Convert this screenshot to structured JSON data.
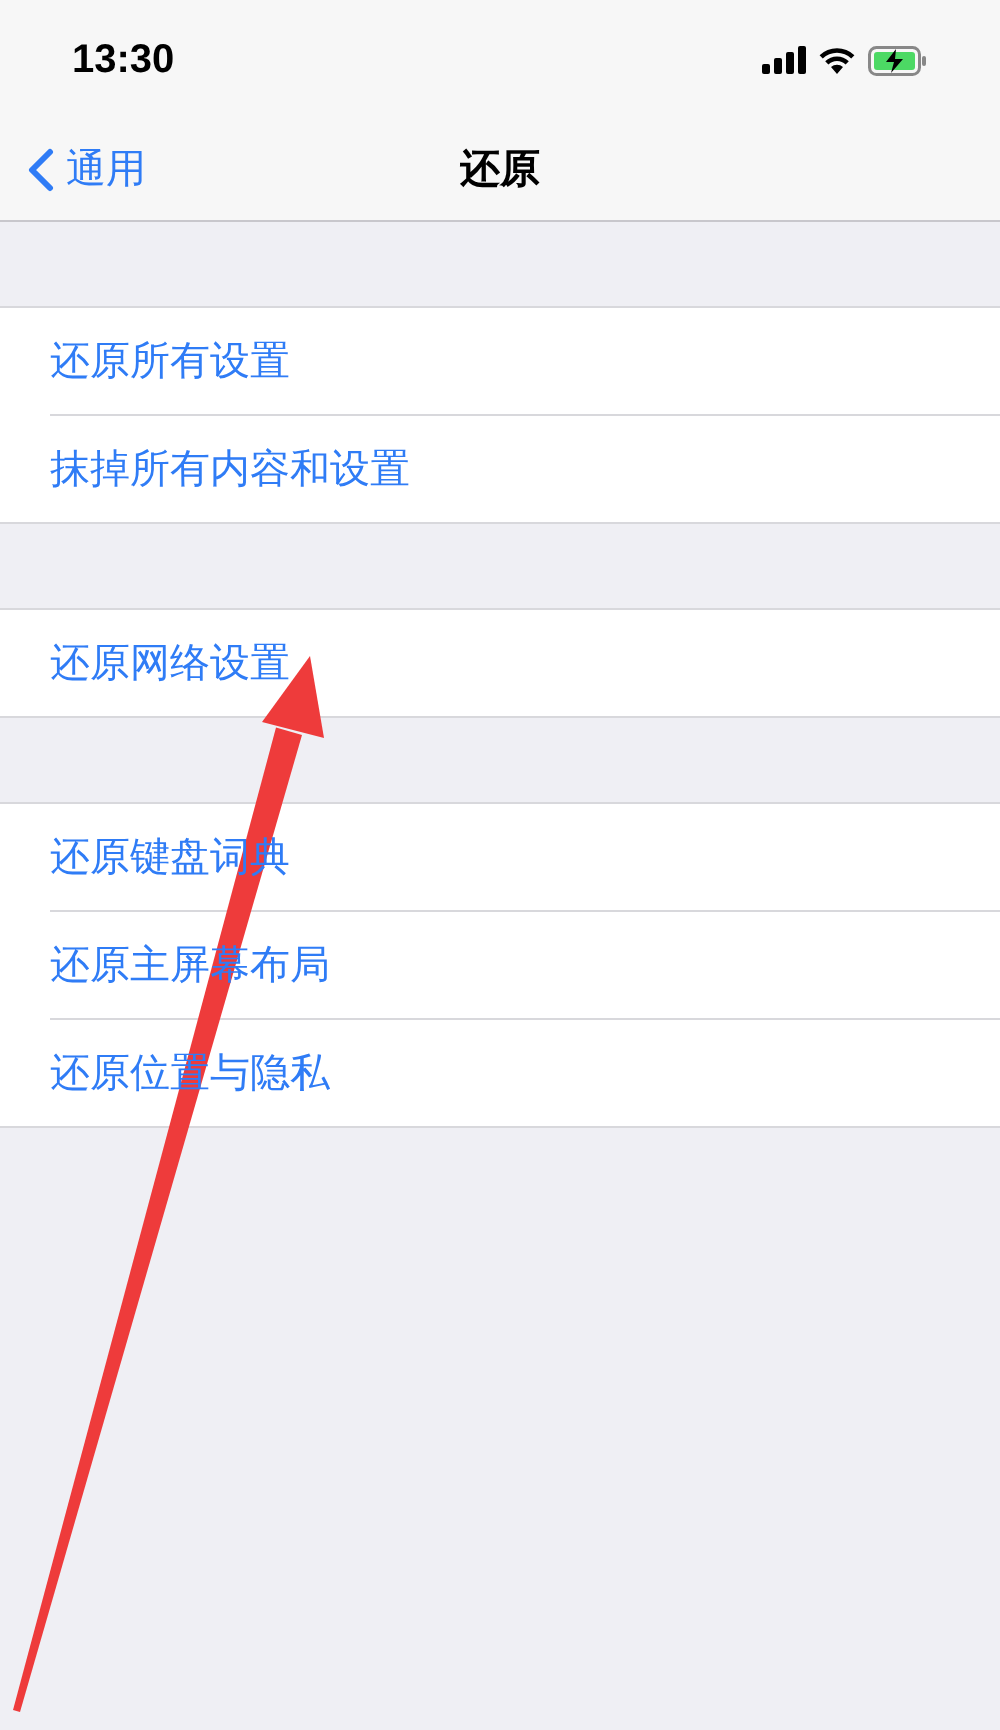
{
  "status_bar": {
    "time": "13:30"
  },
  "nav": {
    "back": "通用",
    "title": "还原"
  },
  "groups": [
    {
      "rows": [
        "还原所有设置",
        "抹掉所有内容和设置"
      ]
    },
    {
      "rows": [
        "还原网络设置"
      ]
    },
    {
      "rows": [
        "还原键盘词典",
        "还原主屏幕布局",
        "还原位置与隐私"
      ]
    }
  ]
}
